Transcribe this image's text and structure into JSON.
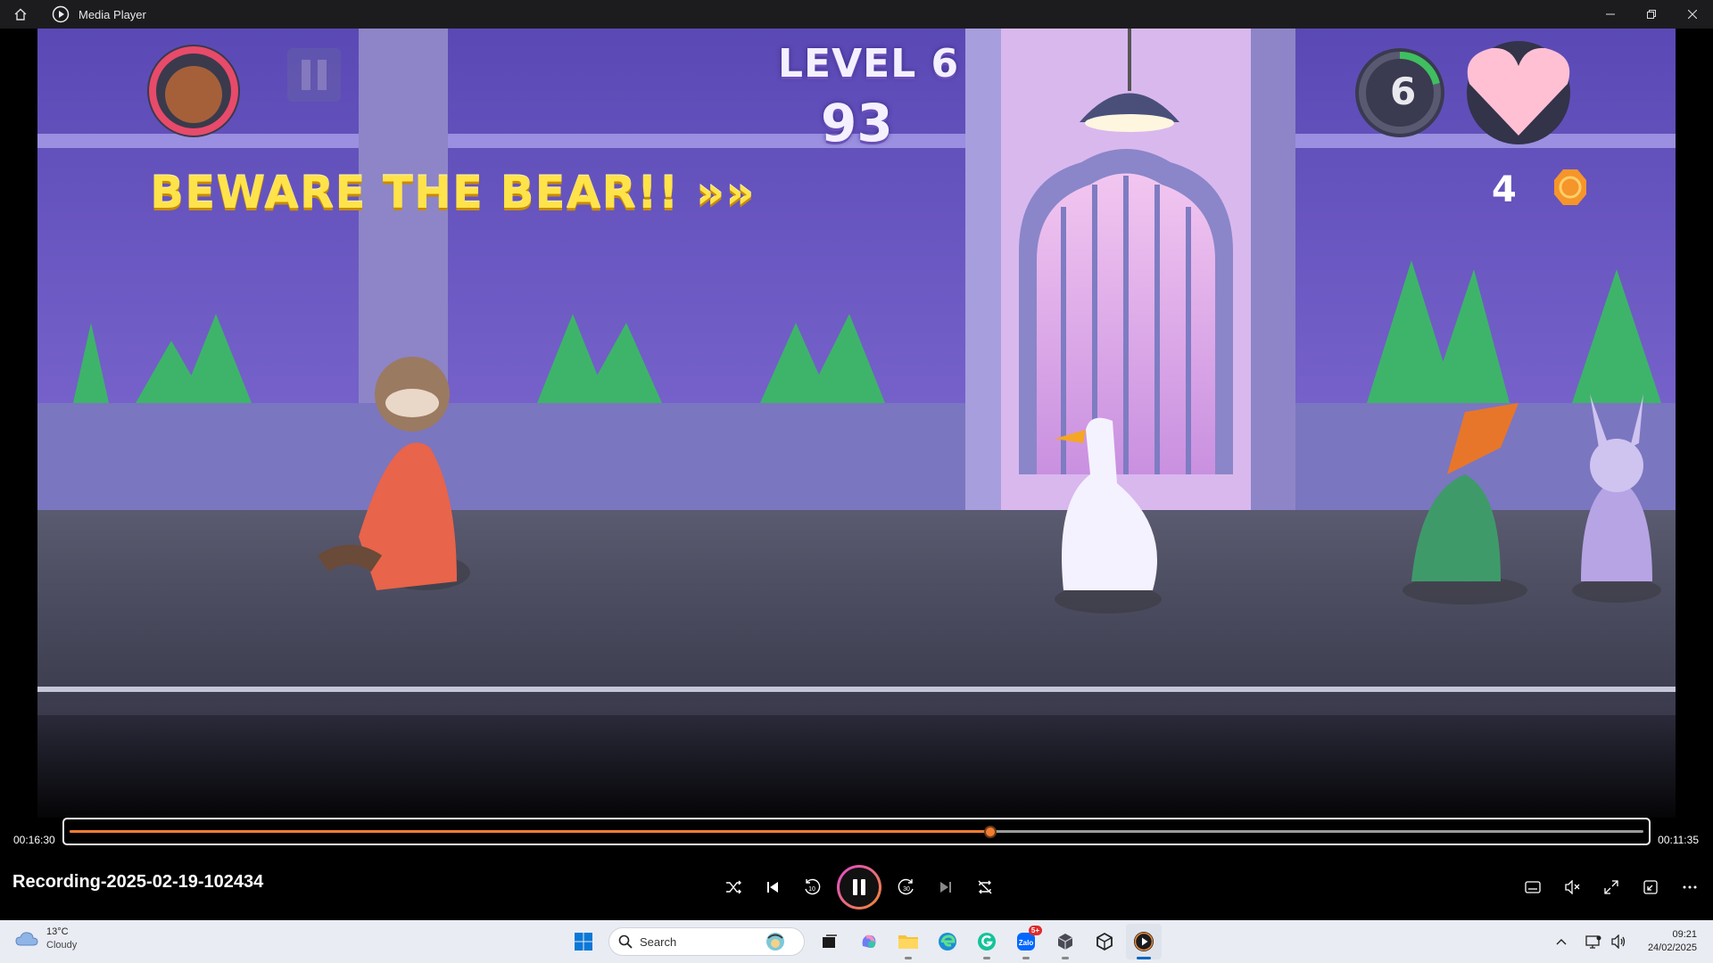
{
  "window": {
    "title": "Media Player",
    "icons": [
      "home-icon",
      "media-player-icon",
      "minimize-icon",
      "restore-icon",
      "close-icon"
    ]
  },
  "video": {
    "level_label": "LEVEL 6",
    "score": "93",
    "banner": "BEWARE THE BEAR!! »»",
    "coins": "4",
    "ring_number": "6",
    "colors": {
      "wall": "#6f5bc7",
      "floor": "#4b4c62",
      "banner": "#ffe34a",
      "heart": "#ffc0d4"
    }
  },
  "player": {
    "file_title": "Recording-2025-02-19-102434",
    "time_elapsed": "00:16:30",
    "time_remaining": "00:11:35",
    "progress_fraction": 0.585,
    "accent": "#f27c32",
    "controls": {
      "shuffle": "shuffle-icon",
      "previous": "previous-icon",
      "rewind": "10",
      "pause": "pause-icon",
      "forward": "30",
      "next": "next-icon",
      "repeat": "repeat-off-icon"
    },
    "right_controls": [
      "captions-icon",
      "mute-icon",
      "fullscreen-icon",
      "mini-player-icon",
      "more-icon"
    ]
  },
  "taskbar": {
    "weather_temp": "13°C",
    "weather_desc": "Cloudy",
    "search_placeholder": "Search",
    "badge_count": "5+",
    "clock_time": "09:21",
    "clock_date": "24/02/2025"
  }
}
